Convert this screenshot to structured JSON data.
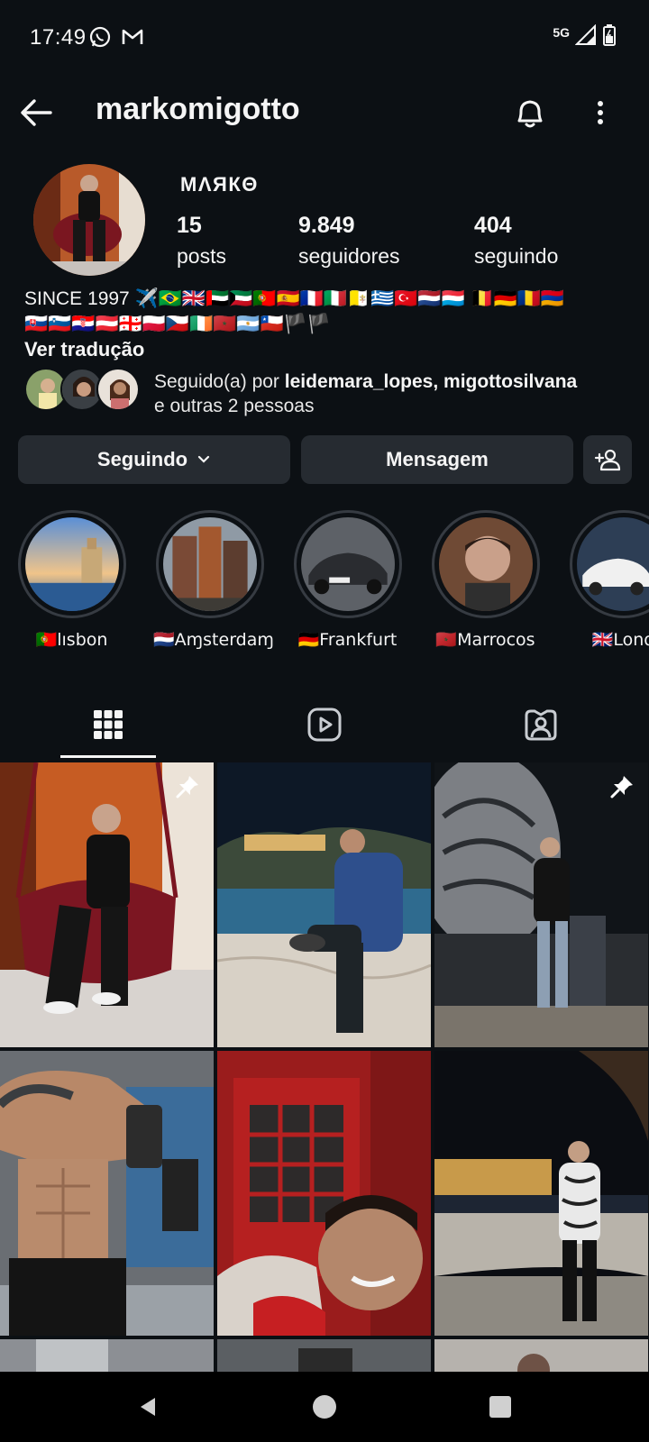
{
  "status_bar": {
    "time": "17:49",
    "network": "5G"
  },
  "header": {
    "username": "markomigotto",
    "back_icon": "arrow-left-icon",
    "bell_icon": "bell-icon",
    "more_icon": "more-vertical-icon"
  },
  "profile": {
    "display_name": "МΛЯКΘ",
    "stats": [
      {
        "value": "15",
        "label": "posts"
      },
      {
        "value": "9.849",
        "label": "seguidores"
      },
      {
        "value": "404",
        "label": "seguindo"
      }
    ],
    "bio_line1": "SINCE 1997 ✈️🇧🇷🇬🇧🇦🇪🇰🇼🇵🇹🇪🇸🇫🇷🇮🇹🇻🇦🇬🇷🇹🇷🇳🇱🇱🇺 🇧🇪🇩🇪🇷🇴🇦🇲",
    "bio_line2": "🇸🇰🇸🇮🇭🇷🇦🇹🇬🇪🇵🇱🇨🇿🇮🇪🇲🇦🇦🇷🇨🇱🏴🏴",
    "translate_label": "Ver tradução",
    "followed_by_prefix": "Seguido(a) por ",
    "followed_by_names": "leidemara_lopes, migottosilvana",
    "followed_by_suffix": "e outras 2 pessoas"
  },
  "actions": {
    "following_label": "Seguindo",
    "message_label": "Mensagem"
  },
  "highlights": [
    {
      "label": "🇵🇹lısbon"
    },
    {
      "label": "🇳🇱Aɱsterdaɱ"
    },
    {
      "label": "🇩🇪Frankfurt"
    },
    {
      "label": "🇲🇦Marrocos"
    },
    {
      "label": "🇬🇧Lond"
    }
  ],
  "tabs": [
    {
      "name": "grid",
      "icon": "grid-icon",
      "active": true
    },
    {
      "name": "reels",
      "icon": "reels-icon",
      "active": false
    },
    {
      "name": "tagged",
      "icon": "tagged-person-icon",
      "active": false
    }
  ],
  "colors": {
    "background": "#0c1014",
    "button_bg": "#262b31",
    "text": "#f5f5f5"
  }
}
